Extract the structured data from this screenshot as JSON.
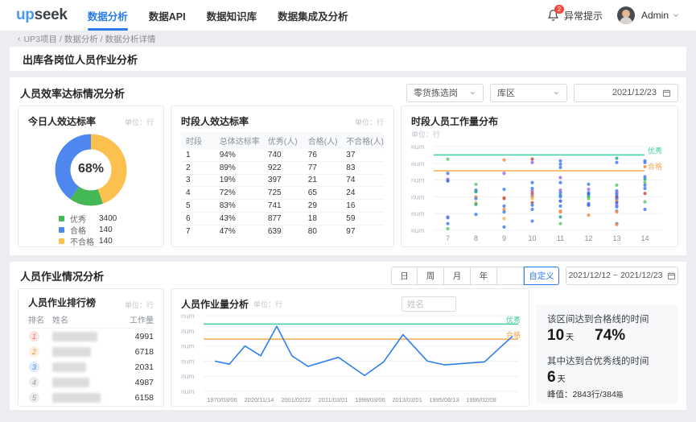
{
  "header": {
    "logo_part1": "up",
    "logo_part2": "seek",
    "nav": [
      {
        "label": "数据分析",
        "active": true
      },
      {
        "label": "数据API",
        "active": false
      },
      {
        "label": "数据知识库",
        "active": false
      },
      {
        "label": "数据集成及分析",
        "active": false
      }
    ],
    "alert_badge": "2",
    "alert_label": "异常提示",
    "user_name": "Admin"
  },
  "breadcrumb": {
    "back": "‹",
    "items": [
      "UP3项目",
      "数据分析",
      "数据分析详情"
    ]
  },
  "page_title": "出库各岗位人员作业分析",
  "section1": {
    "title": "人员效率达标情况分析",
    "filters": {
      "post_select": "零货拣选岗",
      "area_select": "库区",
      "date": "2021/12/23"
    },
    "donut_card": {
      "title": "今日人效达标率",
      "unit_label": "单位：行"
    },
    "table_card": {
      "title": "时段人效达标率",
      "unit_label": "单位：行",
      "columns": [
        "时段",
        "总体达标率",
        "优秀(人)",
        "合格(人)",
        "不合格(人)"
      ],
      "rows": [
        [
          "1",
          "94%",
          "740",
          "76",
          "37"
        ],
        [
          "2",
          "89%",
          "922",
          "77",
          "83"
        ],
        [
          "3",
          "19%",
          "397",
          "21",
          "74"
        ],
        [
          "4",
          "72%",
          "725",
          "65",
          "24"
        ],
        [
          "5",
          "83%",
          "741",
          "29",
          "16"
        ],
        [
          "6",
          "43%",
          "877",
          "18",
          "59"
        ],
        [
          "7",
          "47%",
          "639",
          "80",
          "97"
        ]
      ]
    },
    "scatter_card": {
      "title": "时段人员工作量分布",
      "unit_label": "单位：行"
    }
  },
  "section2": {
    "title": "人员作业情况分析",
    "tabs": [
      "日",
      "周",
      "月",
      "年",
      ""
    ],
    "custom_tab": "自定义",
    "date_range": "2021/12/12 ~ 2021/12/23",
    "rank_card": {
      "title": "人员作业排行榜",
      "unit_label": "单位：行",
      "columns": [
        "排名",
        "姓名",
        "工作量"
      ],
      "rows": [
        {
          "rank": "1",
          "value": "4991"
        },
        {
          "rank": "2",
          "value": "6718"
        },
        {
          "rank": "3",
          "value": "2031"
        },
        {
          "rank": "4",
          "value": "4987"
        },
        {
          "rank": "5",
          "value": "6158"
        }
      ]
    },
    "line_card": {
      "title": "人员作业量分析",
      "unit_label": "单位：行",
      "name_placeholder": "姓名"
    },
    "stats": {
      "line1": "该区间达到合格线的时间",
      "days1": "10",
      "days_unit": "天",
      "pct": "74%",
      "line2": "其中达到合优秀线的时间",
      "days2": "6",
      "peak_label": "峰值：",
      "peak_value": "2843行/384",
      "peak_suffix": "箱"
    }
  },
  "chart_data": [
    {
      "type": "pie",
      "title": "今日人效达标率",
      "center_label": "68%",
      "unit": "行",
      "legend": [
        {
          "label": "优秀",
          "value": 3400,
          "color": "#43b854"
        },
        {
          "label": "合格",
          "value": 140,
          "color": "#4e87ee"
        },
        {
          "label": "不合格",
          "value": 140,
          "color": "#fbc04d"
        }
      ],
      "segments": [
        {
          "name": "不合格",
          "color": "#fbc04d",
          "deg": 160
        },
        {
          "name": "优秀",
          "color": "#43b854",
          "deg": 55
        },
        {
          "name": "合格",
          "color": "#4e87ee",
          "deg": 145
        }
      ]
    },
    {
      "type": "scatter",
      "title": "时段人员工作量分布",
      "unit": "行",
      "x_categories": [
        7,
        8,
        9,
        10,
        11,
        12,
        13,
        14
      ],
      "y_tick_label": "num",
      "y_ticks": 6,
      "ylim": [
        0,
        100
      ],
      "ref_lines": [
        {
          "label": "优秀",
          "value": 90,
          "color": "#3ecca4"
        },
        {
          "label": "合格",
          "value": 71,
          "color": "#f5a94f"
        }
      ],
      "palette": {
        "blue": "#4a7ff0",
        "green": "#5ecb71",
        "teal": "#2aa888",
        "orange": "#f78f44",
        "purple": "#a06ee0",
        "red": "#c0564a",
        "navy": "#3a5fd9",
        "gold": "#f0b64c"
      },
      "points": [
        [
          7,
          85,
          "green"
        ],
        [
          7,
          68,
          "blue"
        ],
        [
          7,
          61,
          "purple"
        ],
        [
          7,
          59,
          "navy"
        ],
        [
          7,
          16,
          "purple"
        ],
        [
          7,
          15,
          "blue"
        ],
        [
          7,
          8,
          "blue"
        ],
        [
          7,
          2,
          "green"
        ],
        [
          8,
          55,
          "green"
        ],
        [
          8,
          48,
          "blue"
        ],
        [
          8,
          46,
          "teal"
        ],
        [
          8,
          40,
          "orange"
        ],
        [
          8,
          38,
          "blue"
        ],
        [
          8,
          33,
          "gold"
        ],
        [
          8,
          31,
          "teal"
        ],
        [
          8,
          19,
          "blue"
        ],
        [
          9,
          84,
          "orange"
        ],
        [
          9,
          68,
          "purple"
        ],
        [
          9,
          49,
          "blue"
        ],
        [
          9,
          39,
          "orange"
        ],
        [
          9,
          38,
          "red"
        ],
        [
          9,
          29,
          "blue"
        ],
        [
          9,
          25,
          "orange"
        ],
        [
          9,
          22,
          "blue"
        ],
        [
          9,
          14,
          "gold"
        ],
        [
          9,
          4,
          "blue"
        ],
        [
          10,
          85,
          "red"
        ],
        [
          10,
          81,
          "purple"
        ],
        [
          10,
          57,
          "blue"
        ],
        [
          10,
          50,
          "blue"
        ],
        [
          10,
          47,
          "purple"
        ],
        [
          10,
          44,
          "red"
        ],
        [
          10,
          41,
          "blue"
        ],
        [
          10,
          40,
          "orange"
        ],
        [
          10,
          38,
          "gold"
        ],
        [
          10,
          33,
          "red"
        ],
        [
          10,
          30,
          "blue"
        ],
        [
          10,
          25,
          "blue"
        ],
        [
          10,
          11,
          "blue"
        ],
        [
          11,
          83,
          "blue"
        ],
        [
          11,
          79,
          "blue"
        ],
        [
          11,
          75,
          "blue"
        ],
        [
          11,
          63,
          "purple"
        ],
        [
          11,
          57,
          "blue"
        ],
        [
          11,
          48,
          "purple"
        ],
        [
          11,
          45,
          "blue"
        ],
        [
          11,
          42,
          "teal"
        ],
        [
          11,
          40,
          "blue"
        ],
        [
          11,
          35,
          "navy"
        ],
        [
          11,
          29,
          "blue"
        ],
        [
          11,
          23,
          "orange"
        ],
        [
          11,
          22,
          "orange"
        ],
        [
          11,
          16,
          "teal"
        ],
        [
          11,
          8,
          "green"
        ],
        [
          12,
          55,
          "blue"
        ],
        [
          12,
          49,
          "purple"
        ],
        [
          12,
          45,
          "blue"
        ],
        [
          12,
          43,
          "navy"
        ],
        [
          12,
          40,
          "teal"
        ],
        [
          12,
          38,
          "green"
        ],
        [
          12,
          32,
          "blue"
        ],
        [
          12,
          30,
          "navy"
        ],
        [
          12,
          18,
          "orange"
        ],
        [
          13,
          86,
          "teal"
        ],
        [
          13,
          81,
          "blue"
        ],
        [
          13,
          54,
          "green"
        ],
        [
          13,
          47,
          "blue"
        ],
        [
          13,
          45,
          "purple"
        ],
        [
          13,
          43,
          "blue"
        ],
        [
          13,
          40,
          "navy"
        ],
        [
          13,
          39,
          "red"
        ],
        [
          13,
          37,
          "blue"
        ],
        [
          13,
          35,
          "orange"
        ],
        [
          13,
          33,
          "navy"
        ],
        [
          13,
          30,
          "purple"
        ],
        [
          13,
          28,
          "blue"
        ],
        [
          13,
          23,
          "blue"
        ],
        [
          13,
          22,
          "orange"
        ],
        [
          13,
          8,
          "blue"
        ],
        [
          13,
          7,
          "orange"
        ],
        [
          14,
          83,
          "blue"
        ],
        [
          14,
          81,
          "blue"
        ],
        [
          14,
          76,
          "orange"
        ],
        [
          14,
          64,
          "blue"
        ],
        [
          14,
          61,
          "teal"
        ],
        [
          14,
          57,
          "green"
        ],
        [
          14,
          54,
          "blue"
        ],
        [
          14,
          50,
          "blue"
        ],
        [
          14,
          44,
          "red"
        ],
        [
          14,
          34,
          "green"
        ],
        [
          14,
          25,
          "blue"
        ]
      ]
    },
    {
      "type": "line",
      "title": "人员作业量分析",
      "unit": "行",
      "x_labels": [
        "1970/03/06",
        "2020/11/14",
        "2001/02/22",
        "2011/03/01",
        "1998/03/06",
        "2013/03/01",
        "1995/08/13",
        "1996/02/08"
      ],
      "y_tick_label": "num",
      "y_ticks": 6,
      "ylim": [
        0,
        100
      ],
      "ref_lines": [
        {
          "label": "优秀",
          "value": 89,
          "color": "#3ecca4"
        },
        {
          "label": "合格",
          "value": 69,
          "color": "#f5a94f"
        }
      ],
      "series": [
        {
          "name": "工作量",
          "color": "#2e7ef2",
          "points": [
            [
              0,
              40
            ],
            [
              4.9,
              36
            ],
            [
              10.1,
              60
            ],
            [
              15.4,
              47
            ],
            [
              20.8,
              86
            ],
            [
              25.9,
              47
            ],
            [
              31.3,
              33
            ],
            [
              41.5,
              45
            ],
            [
              50.3,
              21
            ],
            [
              56.7,
              39
            ],
            [
              63.2,
              75
            ],
            [
              71.4,
              40
            ],
            [
              77.2,
              35
            ],
            [
              90.6,
              39
            ],
            [
              100,
              73
            ]
          ]
        }
      ]
    }
  ]
}
